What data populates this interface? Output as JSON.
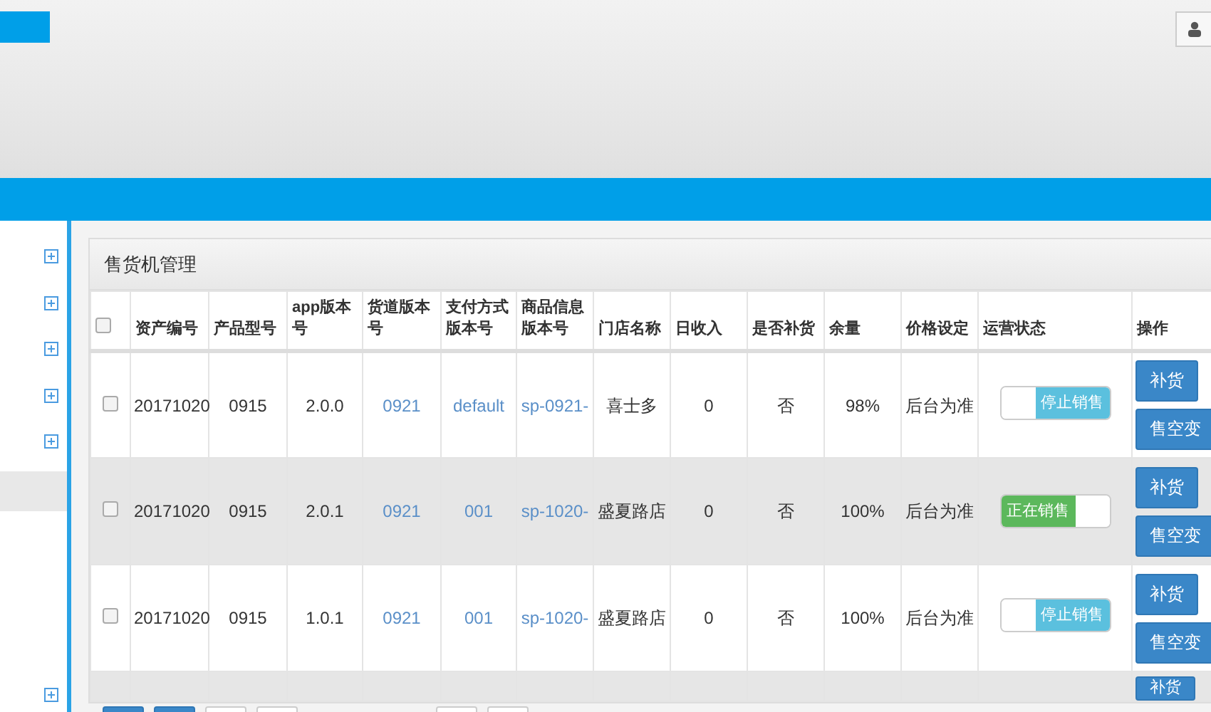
{
  "sidebar": {
    "items": [
      {
        "kind": "expandable",
        "selected": false
      },
      {
        "kind": "expandable",
        "selected": false
      },
      {
        "kind": "expandable",
        "selected": false
      },
      {
        "kind": "expandable",
        "selected": false
      },
      {
        "kind": "expandable",
        "selected": false
      },
      {
        "kind": "plain",
        "selected": true
      },
      {
        "kind": "expandable",
        "selected": false
      }
    ]
  },
  "panel": {
    "title": "售货机管理",
    "table": {
      "select_all": {
        "checked": false
      },
      "columns": [
        "资产编号",
        "产品型号",
        "app版本号",
        "货道版本号",
        "支付方式版本号",
        "商品信息版本号",
        "门店名称",
        "日收入",
        "是否补货",
        "余量",
        "价格设定",
        "运营状态",
        "操作"
      ],
      "rows": [
        {
          "kind": "full",
          "checked": false,
          "asset_no": "20171020",
          "model": "0915",
          "app_version": "2.0.0",
          "lane_version": "0921",
          "payment_version": "default",
          "product_version": "sp-0921-",
          "store": "喜士多",
          "daily_income": "0",
          "restock": "否",
          "remaining": "98%",
          "price": "后台为准",
          "status": {
            "on": false,
            "label": "停止销售"
          },
          "actions": [
            "补货",
            "售空变"
          ]
        },
        {
          "kind": "full",
          "checked": false,
          "asset_no": "20171020",
          "model": "0915",
          "app_version": "2.0.1",
          "lane_version": "0921",
          "payment_version": "001",
          "product_version": "sp-1020-",
          "store": "盛夏路店",
          "daily_income": "0",
          "restock": "否",
          "remaining": "100%",
          "price": "后台为准",
          "status": {
            "on": true,
            "label": "正在销售"
          },
          "actions": [
            "补货",
            "售空变"
          ]
        },
        {
          "kind": "full",
          "checked": false,
          "asset_no": "20171020",
          "model": "0915",
          "app_version": "1.0.1",
          "lane_version": "0921",
          "payment_version": "001",
          "product_version": "sp-1020-",
          "store": "盛夏路店",
          "daily_income": "0",
          "restock": "否",
          "remaining": "100%",
          "price": "后台为准",
          "status": {
            "on": false,
            "label": "停止销售"
          },
          "actions": [
            "补货",
            "售空变"
          ]
        },
        {
          "kind": "partial",
          "actions": [
            "补货"
          ]
        }
      ]
    },
    "pager": {
      "buttons": [
        {
          "kind": "primary"
        },
        {
          "kind": "primary"
        },
        {
          "kind": "default"
        },
        {
          "kind": "default"
        },
        {
          "kind": "default"
        },
        {
          "kind": "default"
        }
      ]
    }
  }
}
